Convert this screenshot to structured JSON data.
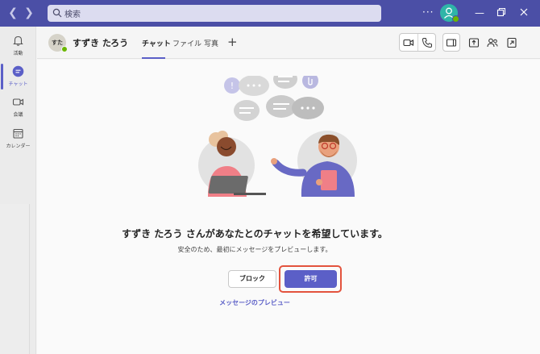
{
  "titlebar": {
    "search_placeholder": "検索",
    "more": "···",
    "accent": "#4b4fa6"
  },
  "rail": {
    "items": [
      {
        "label": "活動",
        "icon": "bell-icon"
      },
      {
        "label": "チャット",
        "icon": "chat-icon",
        "active": true
      },
      {
        "label": "会議",
        "icon": "video-icon"
      },
      {
        "label": "カレンダー",
        "icon": "calendar-icon"
      }
    ]
  },
  "chat": {
    "avatar_initials": "すた",
    "name": "すずき たろう",
    "tabs": [
      {
        "label": "チャット",
        "active": true
      },
      {
        "label": "ファイル"
      },
      {
        "label": "写真"
      }
    ],
    "add_tab": "+"
  },
  "request": {
    "headline": "すずき たろう さんがあなたとのチャットを希望しています。",
    "subtext": "安全のため、最初にメッセージをプレビューします。",
    "block_label": "ブロック",
    "allow_label": "許可",
    "preview_link": "メッセージのプレビュー"
  },
  "colors": {
    "brand": "#5b5fc7",
    "highlight": "#e3533d",
    "presence": "#6bb700"
  }
}
